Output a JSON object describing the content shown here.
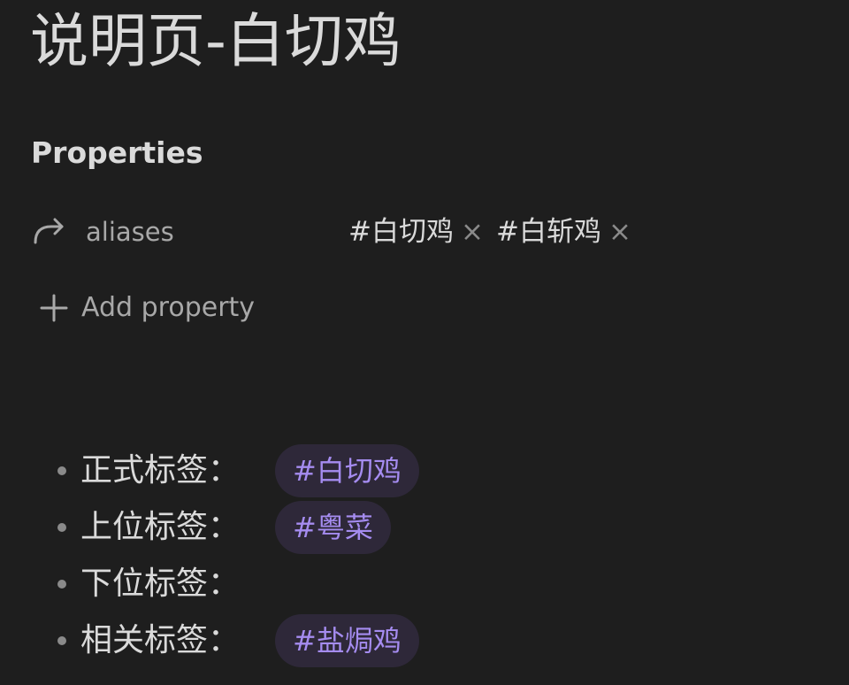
{
  "note": {
    "title": "说明页-白切鸡"
  },
  "properties": {
    "heading": "Properties",
    "items": [
      {
        "icon": "link-arrow-icon",
        "key": "aliases",
        "values": [
          "#白切鸡",
          "#白斩鸡"
        ],
        "remove_glyph": "×"
      }
    ],
    "add_label": "Add property"
  },
  "content": {
    "bullets": [
      {
        "label": "正式标签：",
        "tag": "#白切鸡"
      },
      {
        "label": "上位标签：",
        "tag": "#粤菜"
      },
      {
        "label": "下位标签：",
        "tag": ""
      },
      {
        "label": "相关标签：",
        "tag": "#盐焗鸡"
      }
    ]
  },
  "colors": {
    "background": "#1e1e1e",
    "text": "#dadada",
    "muted": "#a8a8a8",
    "tag_bg": "#2e2839",
    "tag_text": "#a58cf0"
  }
}
